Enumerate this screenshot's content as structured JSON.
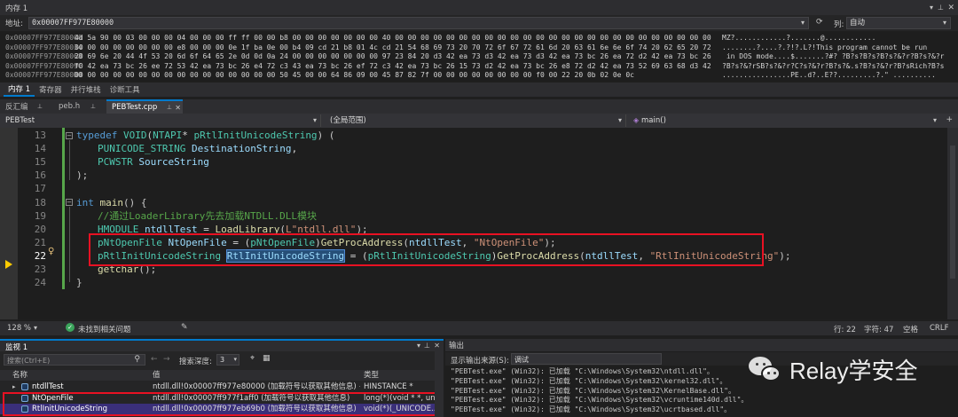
{
  "memory": {
    "title": "内存 1",
    "address_label": "地址:",
    "address_value": "0x00007FF977E80000",
    "columns_label": "列:",
    "columns_value": "自动",
    "rows": [
      {
        "addr": "0x00007FF977E80000",
        "hex": "4d 5a 90 00 03 00 00 00 04 00 00 00 ff ff 00 00 b8 00 00 00 00 00 00 00 40 00 00 00 00 00 00 00 00 00 00 00 00 00 00 00 00 00 00 00 00 00 00 00 00 00 00",
        "ascii": "MZ?............?.......@............"
      },
      {
        "addr": "0x00007FF977E80034",
        "hex": "00 00 00 00 00 00 00 00 e8 00 00 00 0e 1f ba 0e 00 b4 09 cd 21 b8 01 4c cd 21 54 68 69 73 20 70 72 6f 67 72 61 6d 20 63 61 6e 6e 6f 74 20 62 65 20 72 75 6e",
        "ascii": "........?....?.?!?.L?!This program cannot be run"
      },
      {
        "addr": "0x00007FF977E80068",
        "hex": "20 69 6e 20 44 4f 53 20 6d 6f 64 65 2e 0d 0d 0a 24 00 00 00 00 00 00 00 97 23 84 20 d3 42 ea 73 d3 42 ea 73 d3 42 ea 73 bc 26 ea 72 d2 42 ea 73 bc 26 e9 72",
        "ascii": " in DOS mode....$.......?#? ?B?s?B?s?B?s?&?r?B?s?&?r"
      },
      {
        "addr": "0x00007FF977E8009C",
        "hex": "f0 42 ea 73 bc 26 ee 72 53 42 ea 73 bc 26 e4 72 c3 43 ea 73 bc 26 ef 72 c3 42 ea 73 bc 26 15 73 d2 42 ea 73 bc 26 e8 72 d2 42 ea 73 52 69 63 68 d3 42 ea 73",
        "ascii": "?B?s?&?rSB?s?&?r?C?s?&?r?B?s?&.s?B?s?&?r?B?sRich?B?s"
      },
      {
        "addr": "0x00007FF977E800D0",
        "hex": "00 00 00 00 00 00 00 00 00 00 00 00 00 00 00 00 50 45 00 00 64 86 09 00 45 87 82 7f 00 00 00 00 00 00 00 00 f0 00 22 20 0b 02 0e 0c",
        "ascii": "................PE..d?..E??.........?.\" .........."
      }
    ],
    "bottom_tabs": [
      "内存 1",
      "寄存器",
      "并行堆栈",
      "诊断工具"
    ]
  },
  "doc_tabs": [
    "反汇编",
    "peb.h",
    "PEBTest.cpp"
  ],
  "nav": {
    "project": "PEBTest",
    "scope": "(全局范围)",
    "member": "main()"
  },
  "code": [
    {
      "n": "13",
      "parts": [
        [
          "kw",
          "typedef "
        ],
        [
          "ty",
          "VOID"
        ],
        [
          "par",
          "("
        ],
        [
          "ty",
          "NTAPI"
        ],
        [
          "txt",
          "* "
        ],
        [
          "ty",
          "pRtlInitUnicodeString"
        ],
        [
          "par",
          ") ("
        ]
      ]
    },
    {
      "n": "14",
      "parts": [
        [
          "ty",
          "PUNICODE_STRING"
        ],
        [
          "txt",
          " "
        ],
        [
          "var",
          "DestinationString"
        ],
        [
          "txt",
          ","
        ]
      ]
    },
    {
      "n": "15",
      "parts": [
        [
          "ty",
          "PCWSTR"
        ],
        [
          "txt",
          " "
        ],
        [
          "var",
          "SourceString"
        ]
      ]
    },
    {
      "n": "16",
      "parts": [
        [
          "par",
          ");"
        ]
      ]
    },
    {
      "n": "17",
      "parts": []
    },
    {
      "n": "18",
      "parts": [
        [
          "kw",
          "int "
        ],
        [
          "fn",
          "main"
        ],
        [
          "par",
          "() {"
        ]
      ]
    },
    {
      "n": "19",
      "parts": [
        [
          "cm",
          "//通过LoaderLibrary先去加载NTDLL.DLL模块"
        ]
      ]
    },
    {
      "n": "20",
      "parts": [
        [
          "ty",
          "HMODULE"
        ],
        [
          "txt",
          " "
        ],
        [
          "var",
          "ntdllTest"
        ],
        [
          "txt",
          " = "
        ],
        [
          "fn",
          "LoadLibrary"
        ],
        [
          "par",
          "("
        ],
        [
          "str",
          "L\"ntdll.dll\""
        ],
        [
          "par",
          ");"
        ]
      ]
    },
    {
      "n": "21",
      "parts": [
        [
          "ty",
          "pNtOpenFile"
        ],
        [
          "txt",
          " "
        ],
        [
          "var",
          "NtOpenFile"
        ],
        [
          "txt",
          " = ("
        ],
        [
          "ty",
          "pNtOpenFile"
        ],
        [
          "txt",
          ")"
        ],
        [
          "fn",
          "GetProcAddress"
        ],
        [
          "par",
          "("
        ],
        [
          "var",
          "ntdllTest"
        ],
        [
          "txt",
          ", "
        ],
        [
          "str",
          "\"NtOpenFile\""
        ],
        [
          "par",
          ");"
        ]
      ]
    },
    {
      "n": "22",
      "parts": [
        [
          "ty",
          "pRtlInitUnicodeString"
        ],
        [
          "txt",
          " "
        ],
        [
          "var",
          "RtlInitUnicodeString"
        ],
        [
          "txt",
          " = ("
        ],
        [
          "ty",
          "pRtlInitUnicodeString"
        ],
        [
          "txt",
          ")"
        ],
        [
          "fn",
          "GetProcAddress"
        ],
        [
          "par",
          "("
        ],
        [
          "var",
          "ntdllTest"
        ],
        [
          "txt",
          ", "
        ],
        [
          "str",
          "\"RtlInitUnicodeString\""
        ],
        [
          "par",
          ");"
        ]
      ]
    },
    {
      "n": "23",
      "parts": [
        [
          "fn",
          "getchar"
        ],
        [
          "par",
          "();"
        ]
      ]
    },
    {
      "n": "24",
      "parts": [
        [
          "par",
          "}"
        ]
      ]
    }
  ],
  "status": {
    "zoom": "128 %",
    "issues": "未找到相关问题",
    "line": "行: 22",
    "char": "字符: 47",
    "space": "空格",
    "eol": "CRLF"
  },
  "watch": {
    "title": "监视 1",
    "search_placeholder": "搜索(Ctrl+E)",
    "depth_label": "搜索深度:",
    "depth_value": "3",
    "headers": [
      "名称",
      "值",
      "类型"
    ],
    "rows": [
      {
        "name": "ntdllTest",
        "value": "ntdll.dll!0x00007ff977e80000 (加载符号以获取其他信息) {u...",
        "type": "HINSTANCE *"
      },
      {
        "name": "NtOpenFile",
        "value": "ntdll.dll!0x00007ff977f1aff0 (加载符号以获取其他信息)",
        "type": "long(*)(void * *, un..."
      },
      {
        "name": "RtlInitUnicodeString",
        "value": "ntdll.dll!0x00007ff977eb69b0 (加载符号以获取其他信息)",
        "type": "void(*)(_UNICODE..."
      }
    ]
  },
  "output": {
    "title": "输出",
    "source_label": "显示输出来源(S):",
    "source_value": "调试",
    "lines": [
      "\"PEBTest.exe\" (Win32): 已加载 \"C:\\Windows\\System32\\ntdll.dll\"。",
      "\"PEBTest.exe\" (Win32): 已加载 \"C:\\Windows\\System32\\kernel32.dll\"。",
      "\"PEBTest.exe\" (Win32): 已加载 \"C:\\Windows\\System32\\KernelBase.dll\"。",
      "\"PEBTest.exe\" (Win32): 已加载 \"C:\\Windows\\System32\\vcruntime140d.dll\"。",
      "\"PEBTest.exe\" (Win32): 已加载 \"C:\\Windows\\System32\\ucrtbased.dll\"。"
    ]
  },
  "watermark": {
    "brand": "Relay学安全"
  },
  "colors": {
    "accent": "#007acc",
    "highlight": "#e81123",
    "status_purple": "#68217a"
  }
}
